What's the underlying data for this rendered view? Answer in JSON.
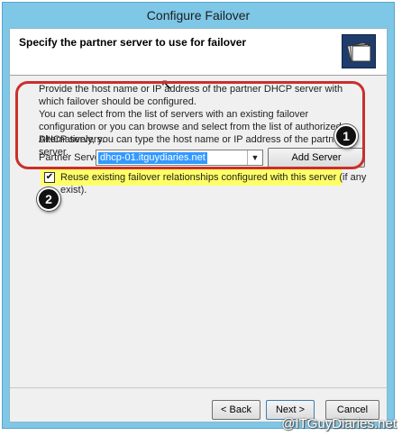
{
  "window": {
    "title": "Configure Failover"
  },
  "header": {
    "title": "Specify the partner server to use for failover",
    "icon": "dhcp-folders-icon"
  },
  "content": {
    "para1": "Provide the host name or IP address of the partner DHCP server with which failover should be configured.",
    "para2": "You can select from the list of servers with an existing failover configuration or you can browse and select from the list of authorized DHCP servers.",
    "para3": "Alternatively, you can type the host name or IP address of the partner server.",
    "partner_label": "Partner Server:",
    "partner_value": "dhcp-01.itguydiaries.net",
    "add_server": "Add Server",
    "reuse_label": "Reuse existing failover relationships configured with this server (if any exist).",
    "reuse_checked": true
  },
  "badges": [
    "1",
    "2"
  ],
  "footer": {
    "back": "< Back",
    "next": "Next >",
    "cancel": "Cancel"
  },
  "watermark": "@ITGuyDiaries.net",
  "colors": {
    "highlight_box": "#c9302c",
    "yellow_highlight": "#ffff66",
    "selection": "#3399ff"
  }
}
